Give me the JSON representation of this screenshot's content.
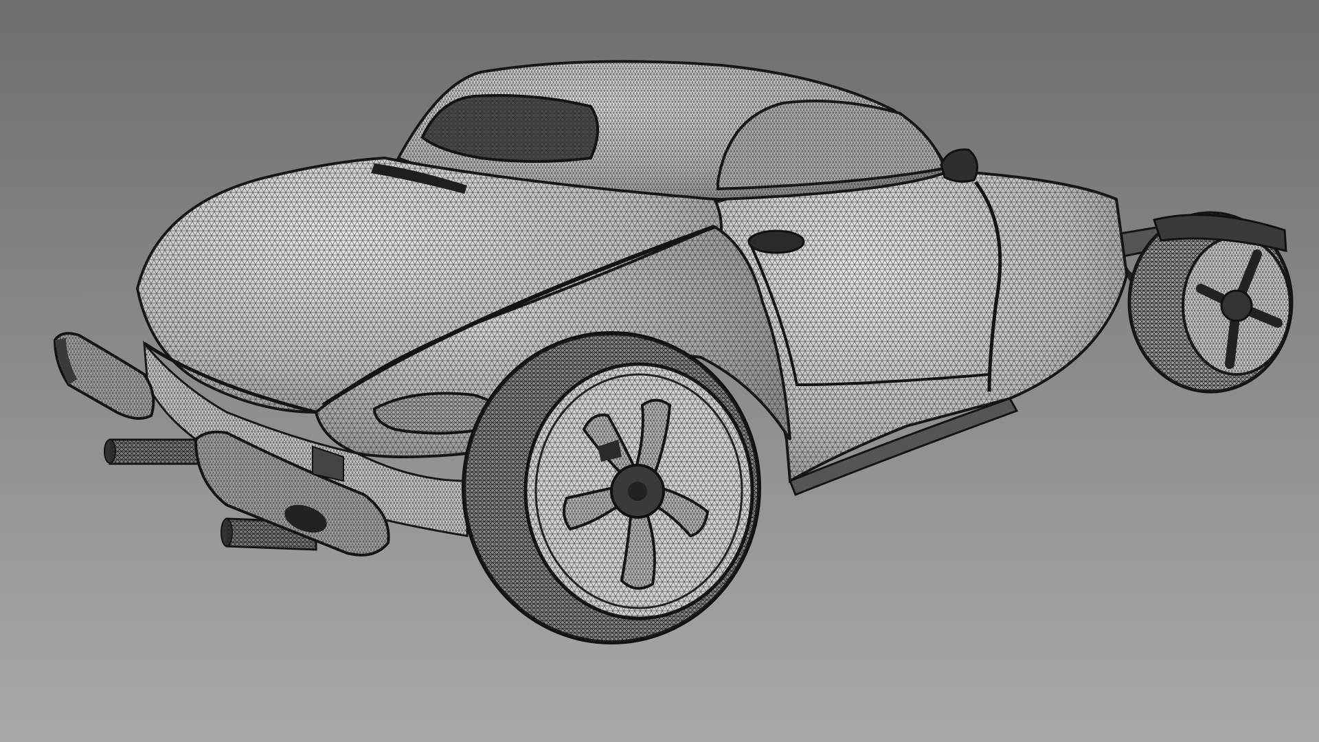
{
  "scene": {
    "subject": "car-wireframe-model",
    "render_mode": "wireframe",
    "colors": {
      "background_top": "#6e6e6e",
      "background_bottom": "#a9a9a9",
      "surface_fill": "#d4d4d4",
      "surface_shade": "#8a8a8a",
      "mesh_line": "#2e2e2e",
      "edge_line": "#141414",
      "dark_part": "#3a3a3a",
      "glass": "#4a4a4a"
    }
  }
}
